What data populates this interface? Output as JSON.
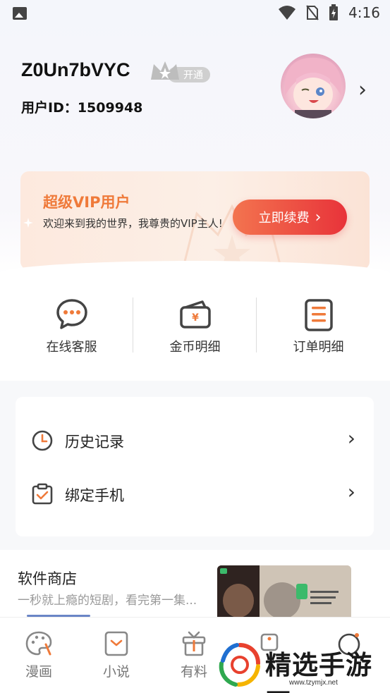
{
  "status_bar": {
    "time": "4:16",
    "icons": [
      "gallery-icon",
      "wifi-icon",
      "no-sim-icon",
      "battery-charging-icon"
    ]
  },
  "profile": {
    "username": "Z0Un7bVYC",
    "vip_badge_label": "开通",
    "user_id": "用户ID：1509948"
  },
  "vip_card": {
    "title": "超级VIP用户",
    "description": "欢迎来到我的世界，我尊贵的VIP主人!",
    "renew_button": "立即续费",
    "colors": {
      "title": "#ef7a3a",
      "button_start": "#f3744f",
      "button_end": "#e8333a"
    }
  },
  "quick_actions": [
    {
      "label": "在线客服",
      "icon": "chat-bubble-icon"
    },
    {
      "label": "金币明细",
      "icon": "wallet-icon"
    },
    {
      "label": "订单明细",
      "icon": "order-list-icon"
    }
  ],
  "menu": [
    {
      "label": "历史记录",
      "icon": "clock-icon"
    },
    {
      "label": "绑定手机",
      "icon": "clipboard-check-icon"
    }
  ],
  "store": {
    "title": "软件商店",
    "subtitle": "一秒就上瘾的短剧，看完第一集..."
  },
  "tabbar": [
    {
      "label": "漫画",
      "icon": "palette-icon"
    },
    {
      "label": "小说",
      "icon": "book-icon"
    },
    {
      "label": "有料",
      "icon": "gift-icon"
    }
  ],
  "watermark": {
    "text": "精选手游网",
    "url": "www.tzymjx.net"
  },
  "accent_colors": {
    "orange": "#ef7a3a",
    "icon_outline": "#444444"
  }
}
